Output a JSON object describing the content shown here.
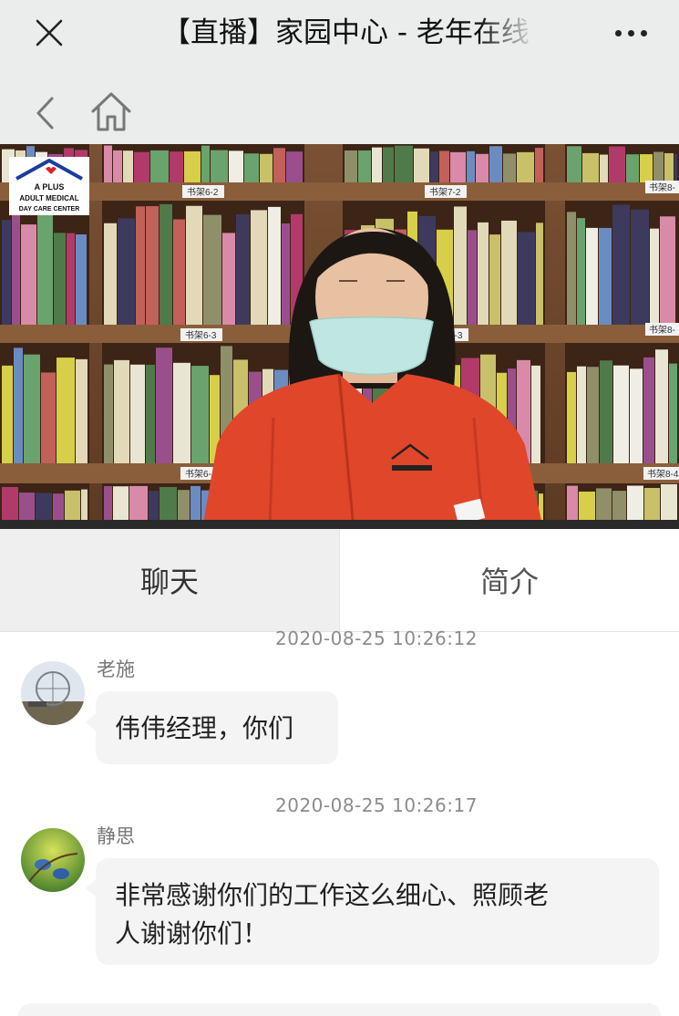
{
  "header": {
    "title": "【直播】家园中心 - 老年在线",
    "close_icon": "close-icon",
    "more_icon": "more-dots-icon",
    "back_icon": "chevron-left-icon",
    "home_icon": "home-icon"
  },
  "video": {
    "logo_line1": "A PLUS",
    "logo_line2": "ADULT MEDICAL",
    "logo_line3": "DAY CARE CENTER",
    "shelf_labels": [
      "书架6-2",
      "书架7-2",
      "书架8-",
      "书架6-3",
      "书架7-3",
      "书架8-",
      "书架6-4",
      "书架8-4"
    ]
  },
  "tabs": [
    {
      "label": "聊天",
      "active": true
    },
    {
      "label": "简介",
      "active": false
    }
  ],
  "messages": [
    {
      "timestamp": "2020-08-25 10:26:12",
      "name": "老施",
      "text": "伟伟经理，你们"
    },
    {
      "timestamp": "2020-08-25 10:26:17",
      "name": "静思",
      "text_line1": "非常感谢你们的工作这么细心、照顾老",
      "text_line2": "人谢谢你们！"
    }
  ],
  "colors": {
    "header_bg": "#ebeded",
    "bubble_bg": "#f4f4f4",
    "active_tab_bg": "#efefef",
    "jacket": "#e0462a"
  }
}
